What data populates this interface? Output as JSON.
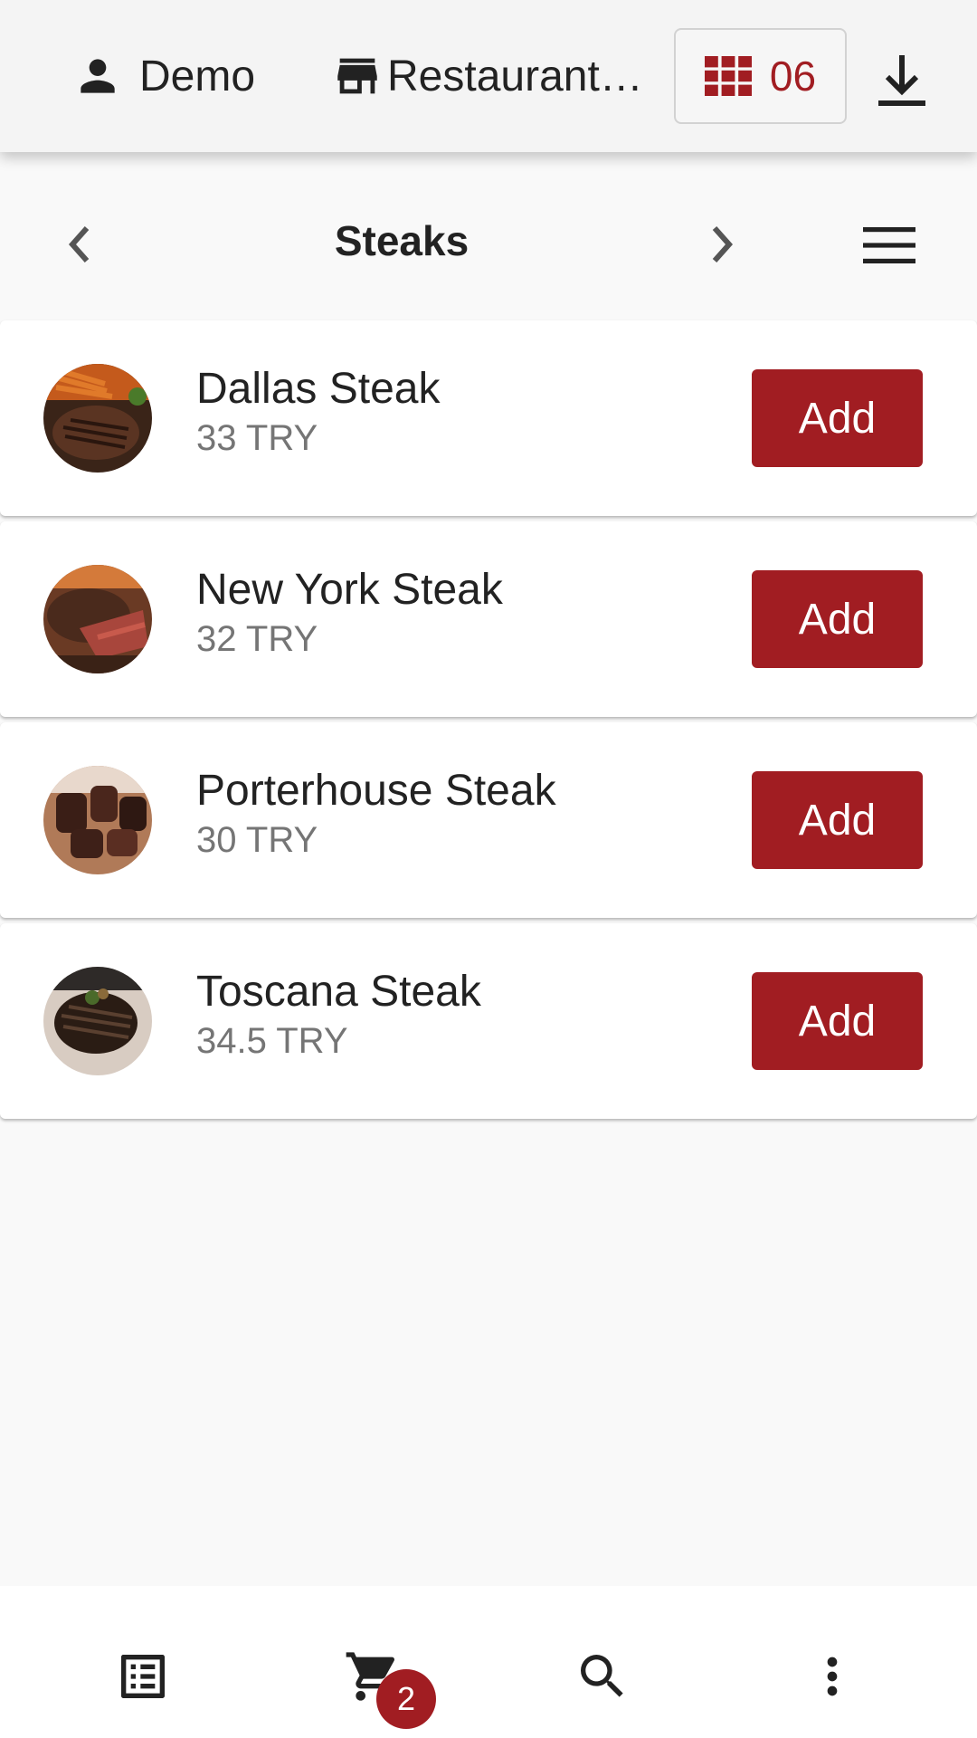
{
  "header": {
    "user_name": "Demo",
    "restaurant_name": "Restaurant…",
    "table_number": "06"
  },
  "category": {
    "title": "Steaks"
  },
  "products": [
    {
      "name": "Dallas Steak",
      "price": "33 TRY",
      "button": "Add"
    },
    {
      "name": "New York Steak",
      "price": "32 TRY",
      "button": "Add"
    },
    {
      "name": "Porterhouse Steak",
      "price": "30 TRY",
      "button": "Add"
    },
    {
      "name": "Toscana Steak",
      "price": "34.5 TRY",
      "button": "Add"
    }
  ],
  "bottom_nav": {
    "cart_count": "2",
    "icons": [
      "orders-list-icon",
      "cart-icon",
      "search-icon",
      "more-vert-icon"
    ]
  },
  "colors": {
    "accent": "#a11d22",
    "topbar_bg": "#f4f4f4",
    "page_bg": "#f9f9f9",
    "price_text": "#757575"
  }
}
